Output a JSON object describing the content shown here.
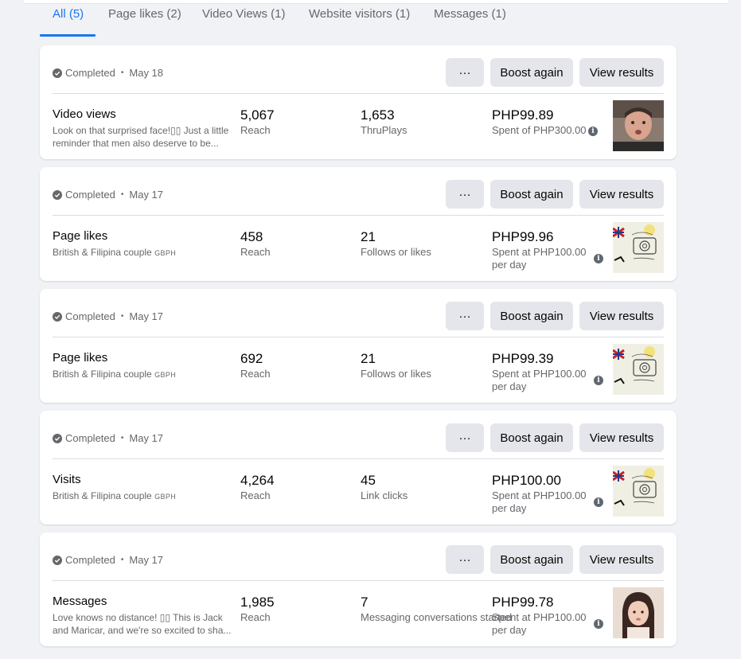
{
  "tabs": [
    {
      "label": "All (5)",
      "active": true
    },
    {
      "label": "Page likes (2)",
      "active": false
    },
    {
      "label": "Video Views (1)",
      "active": false
    },
    {
      "label": "Website visitors (1)",
      "active": false
    },
    {
      "label": "Messages (1)",
      "active": false
    }
  ],
  "actions": {
    "more_label": "···",
    "boost_label": "Boost again",
    "view_label": "View results"
  },
  "colors": {
    "accent": "#1877f2",
    "card_bg": "#ffffff",
    "page_bg": "#f0f2f5",
    "button_bg": "#e4e6eb",
    "secondary_text": "#65676b"
  },
  "campaigns": [
    {
      "status": "Completed",
      "date": "May 18",
      "goal": "Video views",
      "description": "Look on that surprised face!▯▯ Just a little reminder that men also deserve to be...",
      "description_suffix": "",
      "metric1_value": "5,067",
      "metric1_label": "Reach",
      "metric2_value": "1,653",
      "metric2_label": "ThruPlays",
      "spend_value": "PHP99.89",
      "spend_label": "Spent of PHP300.00",
      "thumbnail_icon": "man-portrait-thumbnail"
    },
    {
      "status": "Completed",
      "date": "May 17",
      "goal": "Page likes",
      "description": "British & Filipina couple ",
      "description_suffix": "GBPH",
      "metric1_value": "458",
      "metric1_label": "Reach",
      "metric2_value": "21",
      "metric2_label": "Follows or likes",
      "spend_value": "PHP99.96",
      "spend_label": "Spent at PHP100.00 per day",
      "thumbnail_icon": "camera-logo-thumbnail"
    },
    {
      "status": "Completed",
      "date": "May 17",
      "goal": "Page likes",
      "description": "British & Filipina couple ",
      "description_suffix": "GBPH",
      "metric1_value": "692",
      "metric1_label": "Reach",
      "metric2_value": "21",
      "metric2_label": "Follows or likes",
      "spend_value": "PHP99.39",
      "spend_label": "Spent at PHP100.00 per day",
      "thumbnail_icon": "camera-logo-thumbnail"
    },
    {
      "status": "Completed",
      "date": "May 17",
      "goal": "Visits",
      "description": "British & Filipina couple ",
      "description_suffix": "GBPH",
      "metric1_value": "4,264",
      "metric1_label": "Reach",
      "metric2_value": "45",
      "metric2_label": "Link clicks",
      "spend_value": "PHP100.00",
      "spend_label": "Spent at PHP100.00 per day",
      "thumbnail_icon": "camera-logo-thumbnail"
    },
    {
      "status": "Completed",
      "date": "May 17",
      "goal": "Messages",
      "description": "Love knows no distance! ▯▯ This is Jack and Maricar, and we're so excited to sha...",
      "description_suffix": "",
      "metric1_value": "1,985",
      "metric1_label": "Reach",
      "metric2_value": "7",
      "metric2_label": "Messaging conversations started",
      "spend_value": "PHP99.78",
      "spend_label": "Spent at PHP100.00 per day",
      "thumbnail_icon": "woman-portrait-thumbnail"
    }
  ]
}
